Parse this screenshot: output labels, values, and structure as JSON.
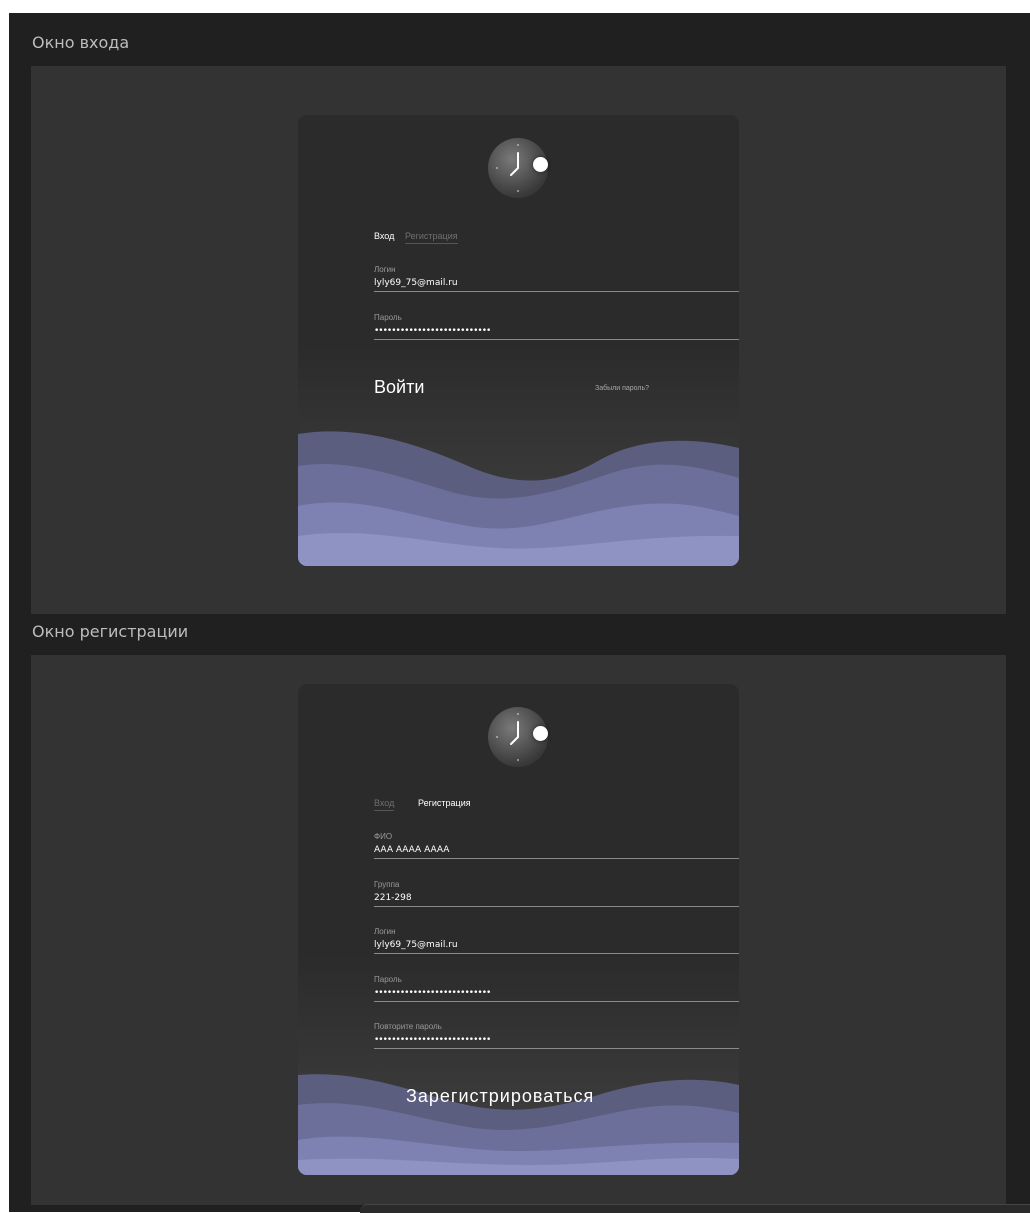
{
  "frames": {
    "login_title": "Окно входа",
    "register_title": "Окно регистрации"
  },
  "login": {
    "tabs": {
      "login": "Вход",
      "register": "Регистрация"
    },
    "fields": {
      "login_label": "Логин",
      "login_value": "lyly69_75@mail.ru",
      "password_label": "Пароль",
      "password_value": "•••••••••••••••••••••••••••"
    },
    "submit": "Войти",
    "forgot": "Забыли пароль?"
  },
  "register": {
    "tabs": {
      "login": "Вход",
      "register": "Регистрация"
    },
    "fields": {
      "fio_label": "ФИО",
      "fio_value": "AAA AAAA AAAA",
      "group_label": "Группа",
      "group_value": "221-298",
      "login_label": "Логин",
      "login_value": "lyly69_75@mail.ru",
      "password_label": "Пароль",
      "password_value": "•••••••••••••••••••••••••••",
      "repeat_label": "Повторите пароль",
      "repeat_value": "•••••••••••••••••••••••••••"
    },
    "submit": "Зарегистрироваться"
  },
  "colors": {
    "board_bg": "#202020",
    "frame_bg": "#333333",
    "card_bg": "#2b2b2b",
    "wave_light": "#8e93c4",
    "wave_dark": "#6c6f9a"
  },
  "icons": {
    "logo": "clock-icon"
  }
}
